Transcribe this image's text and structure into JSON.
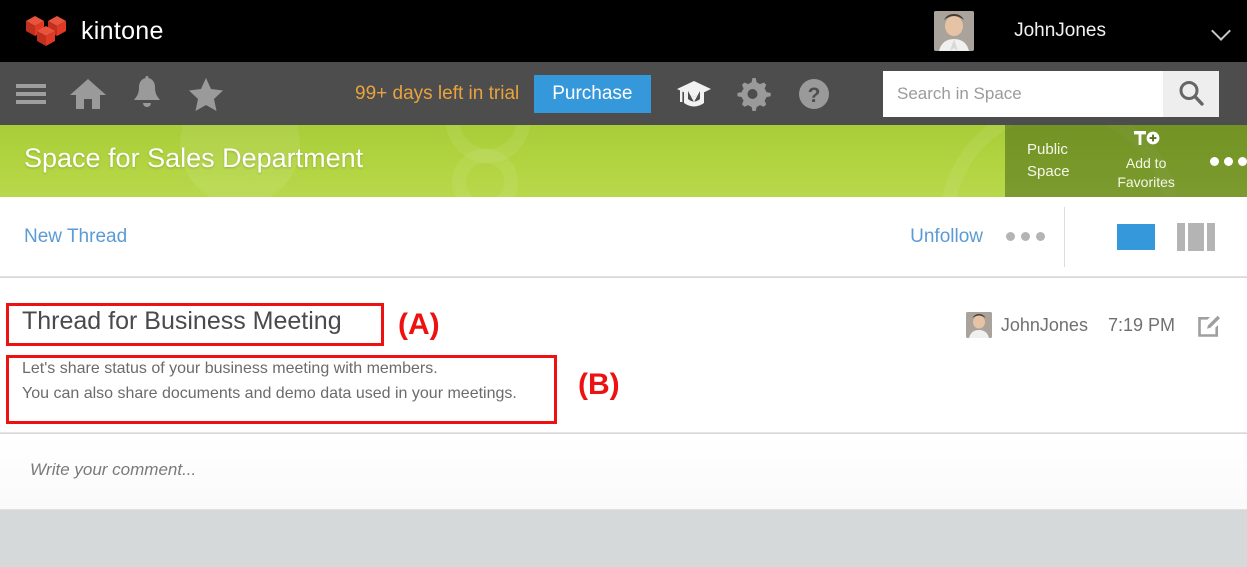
{
  "topbar": {
    "brand": "kintone",
    "brand_icon": "kintone-cube-logo-icon",
    "user_name": "JohnJones",
    "avatar_icon": "user-avatar",
    "caret_icon": "chevron-down-icon"
  },
  "navbar": {
    "menu_icon": "hamburger-menu-icon",
    "home_icon": "home-icon",
    "notifications_icon": "bell-icon",
    "favorites_icon": "star-icon",
    "trial_text": "99+ days left in trial",
    "purchase_label": "Purchase",
    "learning_icon": "graduation-cap-icon",
    "settings_icon": "gear-icon",
    "help_icon": "question-mark-circle-icon",
    "search_placeholder": "Search in Space",
    "search_value": "",
    "search_icon": "magnifier-icon"
  },
  "space": {
    "title": "Space for Sales Department",
    "visibility": "Public\nSpace",
    "visibility_line1": "Public",
    "visibility_line2": "Space",
    "favorite_icon": "pin-add-icon",
    "favorite_label_line1": "Add to",
    "favorite_label_line2": "Favorites",
    "more_icon": "ellipsis-icon"
  },
  "thread_toolbar": {
    "new_thread_label": "New Thread",
    "unfollow_label": "Unfollow",
    "more_icon": "ellipsis-icon",
    "view_single_icon": "single-column-view-icon",
    "view_columns_icon": "multi-column-view-icon"
  },
  "thread": {
    "title": "Thread for Business Meeting",
    "author": "JohnJones",
    "time": "7:19 PM",
    "edit_icon": "edit-pencil-icon",
    "avatar_icon": "user-avatar",
    "body_line1": "Let's share status of your business meeting with members.",
    "body_line2": "You can also share documents and demo data used in your meetings."
  },
  "comment": {
    "placeholder": "Write your comment...",
    "value": ""
  },
  "annotations": [
    {
      "label": "(A)",
      "target": "thread-title"
    },
    {
      "label": "(B)",
      "target": "thread-body-text"
    }
  ],
  "colors": {
    "brand_red": "#e8422c",
    "topbar_black": "#000000",
    "navbar_grey": "#4d4d4d",
    "trial_orange": "#e8a33d",
    "accent_blue": "#3498db",
    "space_green": "#b2d441",
    "space_green_dark": "#566f1f",
    "link_blue": "#5b9bd5",
    "annotation_red": "#ee1111",
    "page_grey": "#d6d9da"
  }
}
